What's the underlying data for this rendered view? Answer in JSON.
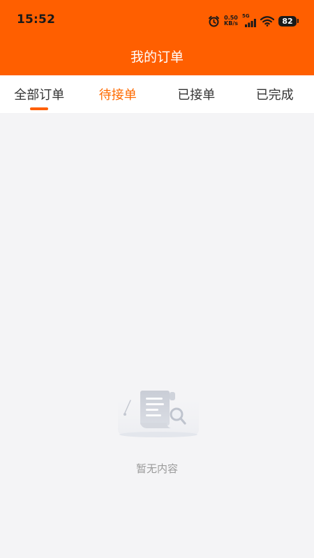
{
  "status_bar": {
    "time": "15:52",
    "net_speed_value": "0.50",
    "net_speed_unit": "KB/s",
    "network_type": "5G",
    "battery_level": "82"
  },
  "header": {
    "title": "我的订单",
    "background_color": "#ff5f00"
  },
  "tabs": [
    {
      "label": "全部订单",
      "selected": true
    },
    {
      "label": "待接单",
      "selected": false,
      "highlight_color": "#ff6a00"
    },
    {
      "label": "已接单",
      "selected": false
    },
    {
      "label": "已完成",
      "selected": false
    }
  ],
  "empty_state": {
    "icon": "empty-document-search-icon",
    "message": "暂无内容"
  }
}
